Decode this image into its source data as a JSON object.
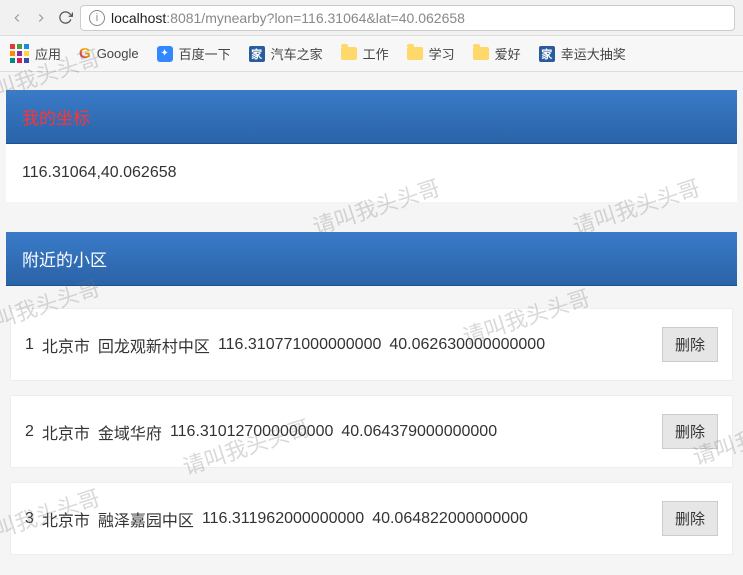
{
  "browser": {
    "url_host": "localhost",
    "url_rest": ":8081/mynearby?lon=116.31064&lat=40.062658"
  },
  "bookmarks": {
    "apps": "应用",
    "google": "Google",
    "baidu": "百度一下",
    "autohome": "汽车之家",
    "work": "工作",
    "study": "学习",
    "hobby": "爱好",
    "lottery": "幸运大抽奖",
    "autohome_icon": "家",
    "lottery_icon": "家"
  },
  "coords": {
    "header": "我的坐标",
    "value": "116.31064,40.062658"
  },
  "nearby": {
    "header": "附近的小区",
    "delete_label": "删除",
    "items": [
      {
        "idx": "1",
        "city": "北京市",
        "name": "回龙观新村中区",
        "lon": "116.310771000000000",
        "lat": "40.062630000000000"
      },
      {
        "idx": "2",
        "city": "北京市",
        "name": "金域华府",
        "lon": "116.310127000000000",
        "lat": "40.064379000000000"
      },
      {
        "idx": "3",
        "city": "北京市",
        "name": "融泽嘉园中区",
        "lon": "116.311962000000000",
        "lat": "40.064822000000000"
      }
    ]
  },
  "watermark": "请叫我头头哥"
}
